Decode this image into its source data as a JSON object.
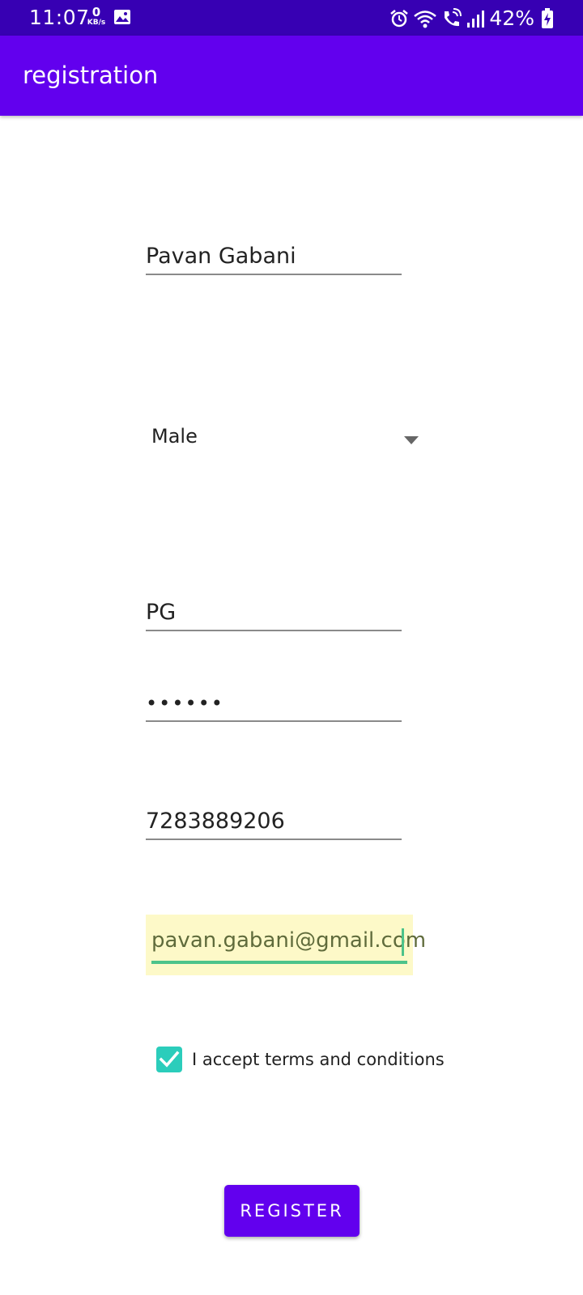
{
  "status_bar": {
    "time": "11:07",
    "net_speed_value": "0",
    "net_speed_unit": "KB/s",
    "battery_percent": "42%",
    "icons": [
      "gallery-icon",
      "alarm-icon",
      "wifi-icon",
      "wifi-calling-icon",
      "signal-icon",
      "battery-charging-icon"
    ]
  },
  "app_bar": {
    "title": "registration"
  },
  "form": {
    "name_value": "Pavan Gabani",
    "gender_selected": "Male",
    "username_value": "PG",
    "password_value": "••••••",
    "phone_value": "7283889206",
    "email_value": "pavan.gabani@gmail.com",
    "terms_label": "I accept terms and conditions",
    "terms_checked": true,
    "register_label": "REGISTER"
  },
  "colors": {
    "status_bar": "#3700b3",
    "primary": "#6200ee",
    "checkbox": "#2bcdbb",
    "email_highlight": "#fdf9c8",
    "focus_underline": "#4cc38a"
  }
}
